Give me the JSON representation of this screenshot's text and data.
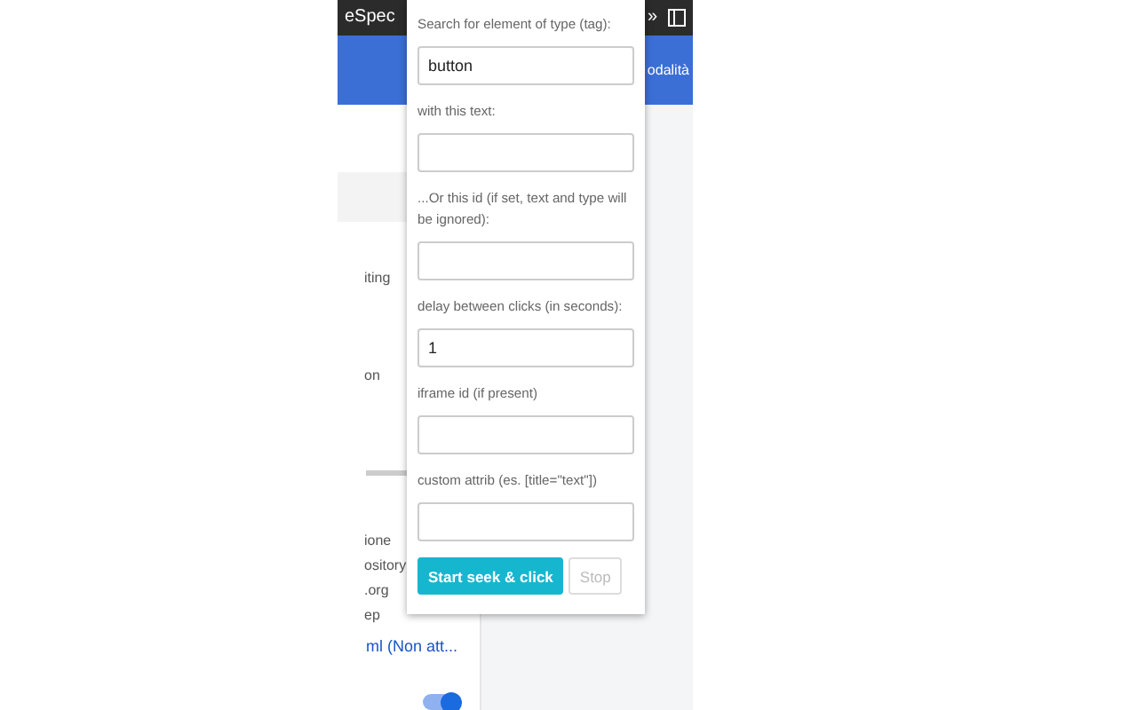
{
  "background_page": {
    "toolbar_title": "eSpec",
    "toolbar_overflow": "»",
    "banner_text": "odalità",
    "sidebar_texts": [
      {
        "text": "iting"
      },
      {
        "text": "on"
      },
      {
        "text": "ione"
      },
      {
        "text": "ository"
      },
      {
        "text": ".org"
      },
      {
        "text": "ep"
      }
    ],
    "link": "ml (Non att...",
    "toggle": {
      "on": true
    }
  },
  "popup": {
    "fields": [
      {
        "label": "Search for element of type (tag):",
        "value": "button"
      },
      {
        "label": "with this text:"
      },
      {
        "label": "...Or this id (if set, text and type will be ignored):"
      },
      {
        "label": "delay between clicks (in seconds):",
        "value": "1"
      },
      {
        "label": "iframe id (if present)"
      },
      {
        "label": "custom attrib (es. [title=\"text\"])"
      }
    ],
    "buttons": [
      {
        "label": "Start seek & click",
        "disabled": false
      },
      {
        "label": "Stop",
        "disabled": true
      }
    ]
  }
}
